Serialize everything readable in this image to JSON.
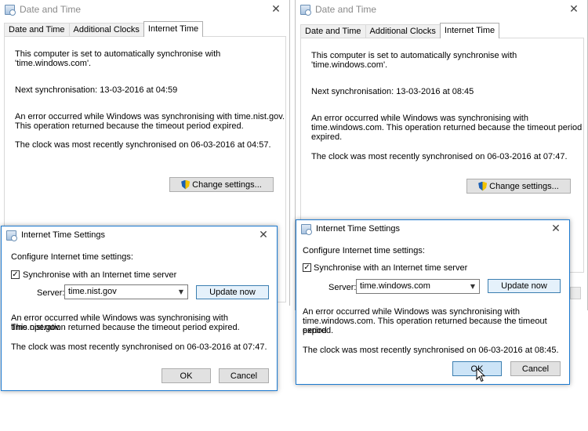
{
  "left": {
    "window_title": "Date and Time",
    "tabs": [
      "Date and Time",
      "Additional Clocks",
      "Internet Time"
    ],
    "sync_info_line1": "This computer is set to automatically synchronise with",
    "sync_info_line2": "'time.windows.com'.",
    "next_sync": "Next synchronisation: 13-03-2016 at 04:59",
    "error_line1": "An error occurred while Windows was synchronising with time.nist.gov.",
    "error_line2": "This operation returned because the timeout period expired.",
    "last_sync": "The clock was most recently synchronised on 06-03-2016 at 04:57.",
    "change_settings": "Change settings...",
    "dialog": {
      "title": "Internet Time Settings",
      "configure_label": "Configure Internet time settings:",
      "checkbox_label": "Synchronise with an Internet time server",
      "checkbox_checked": "✓",
      "server_label": "Server:",
      "server_value": "time.nist.gov",
      "update_now": "Update now",
      "error_line1": "An error occurred while Windows was synchronising with time.nist.gov.",
      "error_line2": "This operation returned because the timeout period expired.",
      "last_sync": "The clock was most recently synchronised on 06-03-2016 at 07:47.",
      "ok": "OK",
      "cancel": "Cancel"
    }
  },
  "right": {
    "window_title": "Date and Time",
    "tabs": [
      "Date and Time",
      "Additional Clocks",
      "Internet Time"
    ],
    "sync_info_line1": "This computer is set to automatically synchronise with",
    "sync_info_line2": "'time.windows.com'.",
    "next_sync": "Next synchronisation: 13-03-2016 at 08:45",
    "error_line1": "An error occurred while Windows was synchronising with",
    "error_line2": "time.windows.com.  This operation returned because the timeout period",
    "error_line3": "expired.",
    "last_sync": "The clock was most recently synchronised on 06-03-2016 at 07:47.",
    "change_settings": "Change settings...",
    "dialog": {
      "title": "Internet Time Settings",
      "configure_label": "Configure Internet time settings:",
      "checkbox_label": "Synchronise with an Internet time server",
      "checkbox_checked": "✓",
      "server_label": "Server:",
      "server_value": "time.windows.com",
      "update_now": "Update now",
      "error_line1": "An error occurred while Windows was synchronising with",
      "error_line2": "time.windows.com.  This operation returned because the timeout period",
      "error_line3": "expired.",
      "last_sync": "The clock was most recently synchronised on 06-03-2016 at 08:45.",
      "ok": "OK",
      "cancel": "Cancel"
    }
  },
  "icons": {
    "close": "✕",
    "dropdown": "▼"
  },
  "colors": {
    "dialog_border": "#1c7ad0",
    "default_button_border": "#3c7fb1",
    "title_inactive": "#8a8a8a"
  }
}
